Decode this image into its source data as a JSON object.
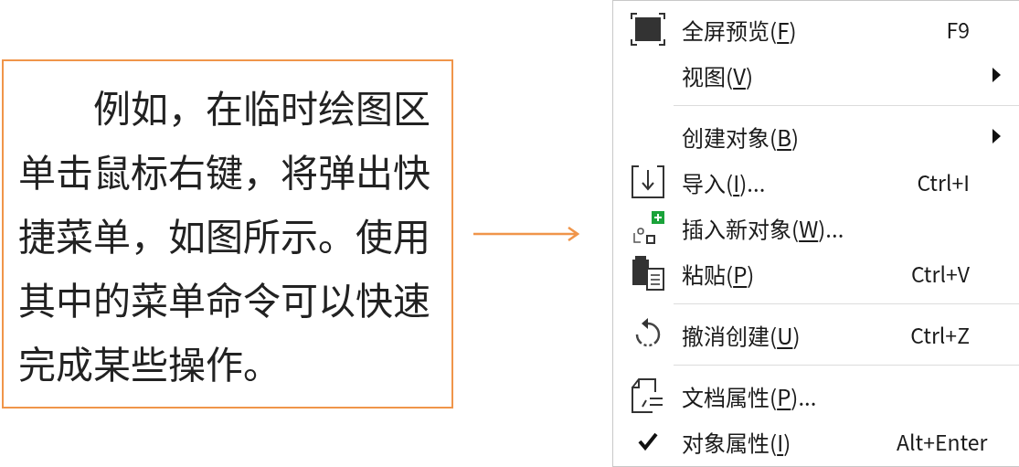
{
  "note": {
    "text": "例如，在临时绘图区单击鼠标右键，将弹出快捷菜单，如图所示。使用其中的菜单命令可以快速完成某些操作。"
  },
  "context_menu": {
    "items": [
      {
        "kind": "item",
        "label_before": "全屏预览(",
        "mnemonic": "F",
        "label_after": ")",
        "shortcut": "F9",
        "checked": false
      },
      {
        "kind": "submenu",
        "label_before": "视图(",
        "mnemonic": "V",
        "label_after": ")",
        "checked": false
      },
      {
        "kind": "separator"
      },
      {
        "kind": "submenu",
        "label_before": "创建对象(",
        "mnemonic": "B",
        "label_after": ")",
        "checked": false
      },
      {
        "kind": "item",
        "label_before": "导入(",
        "mnemonic": "I",
        "label_after": ")...",
        "shortcut": "Ctrl+I",
        "checked": false
      },
      {
        "kind": "item",
        "label_before": "插入新对象(",
        "mnemonic": "W",
        "label_after": ")...",
        "checked": false
      },
      {
        "kind": "item",
        "label_before": "粘贴(",
        "mnemonic": "P",
        "label_after": ")",
        "shortcut": "Ctrl+V",
        "checked": false
      },
      {
        "kind": "separator"
      },
      {
        "kind": "item",
        "label_before": "撤消创建(",
        "mnemonic": "U",
        "label_after": ")",
        "shortcut": "Ctrl+Z",
        "checked": false
      },
      {
        "kind": "separator"
      },
      {
        "kind": "item",
        "label_before": "文档属性(",
        "mnemonic": "P",
        "label_after": ")...",
        "checked": false
      },
      {
        "kind": "item",
        "label_before": "对象属性(",
        "mnemonic": "I",
        "label_after": ")",
        "shortcut": "Alt+Enter",
        "checked": true
      }
    ]
  }
}
